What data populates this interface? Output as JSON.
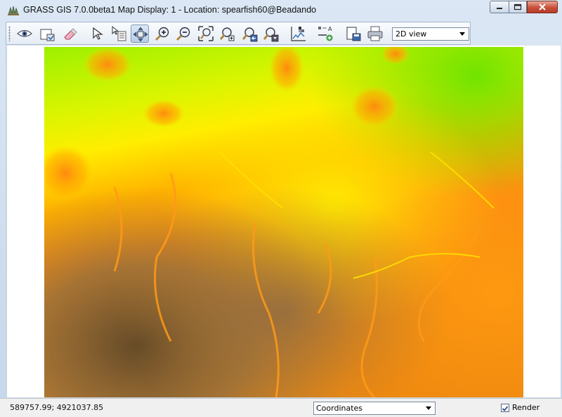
{
  "window": {
    "title": "GRASS GIS 7.0.0beta1 Map Display: 1  - Location: spearfish60@Beadando"
  },
  "toolbar": {
    "buttons": [
      {
        "name": "display-map-icon"
      },
      {
        "name": "render-map-icon"
      },
      {
        "name": "erase-display-icon"
      },
      {
        "name": "pointer-icon"
      },
      {
        "name": "query-icon"
      },
      {
        "name": "pan-icon",
        "active": true
      },
      {
        "name": "zoom-in-icon"
      },
      {
        "name": "zoom-out-icon"
      },
      {
        "name": "zoom-extent-icon"
      },
      {
        "name": "zoom-region-icon"
      },
      {
        "name": "zoom-back-icon"
      },
      {
        "name": "zoom-menu-icon"
      },
      {
        "name": "analyze-icon"
      },
      {
        "name": "overlay-icon"
      },
      {
        "name": "save-image-icon"
      },
      {
        "name": "print-icon"
      }
    ],
    "view_select": "2D view"
  },
  "status": {
    "coordinates": "589757.99; 4921037.85",
    "mode_select": "Coordinates",
    "render_label": "Render",
    "render_checked": true
  },
  "colors": {
    "low": "#5e4a30",
    "mid_low": "#9a7a4e",
    "mid": "#ff8c1a",
    "mid_high": "#ffee00",
    "high": "#8cf000"
  }
}
